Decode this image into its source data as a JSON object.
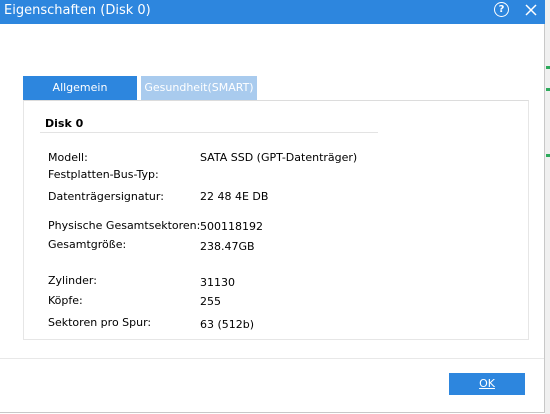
{
  "window": {
    "title": "Eigenschaften (Disk 0)"
  },
  "tabs": [
    {
      "label": "Allgemein"
    },
    {
      "label": "Gesundheit(SMART)"
    }
  ],
  "group": {
    "title": "Disk 0"
  },
  "properties": [
    {
      "label": "Modell:",
      "value": "SATA SSD (GPT-Datenträger)"
    },
    {
      "label": "Festplatten-Bus-Typ:",
      "value": ""
    },
    {
      "label": "Datenträgersignatur:",
      "value": "22 48 4E DB"
    },
    {
      "label": "Physische Gesamtsektoren:",
      "value": "500118192"
    },
    {
      "label": "Gesamtgröße:",
      "value": "238.47GB"
    },
    {
      "label": "Zylinder:",
      "value": "31130"
    },
    {
      "label": "Köpfe:",
      "value": "255"
    },
    {
      "label": "Sektoren pro Spur:",
      "value": "63 (512b)"
    }
  ],
  "footer": {
    "ok_label": "OK"
  },
  "colors": {
    "accent": "#2d86de",
    "tab_inactive": "#a9cbee"
  }
}
